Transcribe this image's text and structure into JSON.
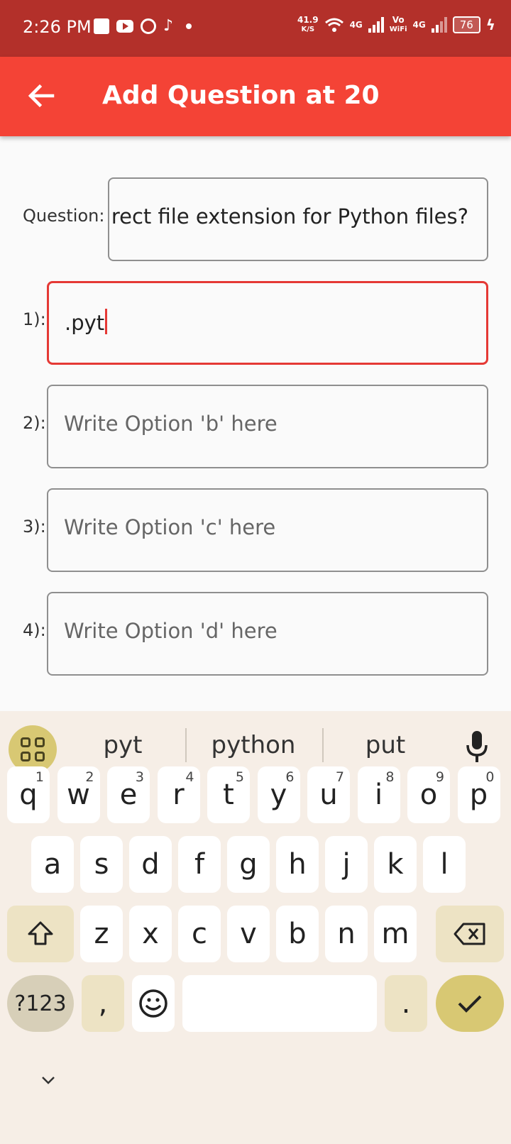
{
  "status_bar": {
    "time": "2:26 PM",
    "net_speed_value": "41.9",
    "net_speed_unit": "K/S",
    "network_1": "4G",
    "volte_top": "Vo",
    "volte_bottom": "WiFi",
    "network_2": "4G",
    "battery": "76",
    "icons": [
      "square-notification-icon",
      "youtube-icon",
      "whatsapp-icon",
      "tiktok-icon",
      "dot-icon",
      "wifi-icon",
      "signal-icon",
      "battery-icon",
      "charging-icon"
    ]
  },
  "app_bar": {
    "title": "Add Question at 20",
    "background": "#f44336",
    "status_background": "#b3302a"
  },
  "form": {
    "question_label": "Question:",
    "question_value": "rect file extension for Python files?",
    "options": [
      {
        "label": "1):",
        "value": ".pyt",
        "placeholder": ""
      },
      {
        "label": "2):",
        "value": "",
        "placeholder": "Write Option 'b' here"
      },
      {
        "label": "3):",
        "value": "",
        "placeholder": "Write Option 'c' here"
      },
      {
        "label": "4):",
        "value": "",
        "placeholder": "Write Option 'd' here"
      }
    ],
    "focus_color": "#e53935"
  },
  "keyboard": {
    "suggestions": [
      "pyt",
      "python",
      "put"
    ],
    "row1": [
      {
        "k": "q",
        "h": "1"
      },
      {
        "k": "w",
        "h": "2"
      },
      {
        "k": "e",
        "h": "3"
      },
      {
        "k": "r",
        "h": "4"
      },
      {
        "k": "t",
        "h": "5"
      },
      {
        "k": "y",
        "h": "6"
      },
      {
        "k": "u",
        "h": "7"
      },
      {
        "k": "i",
        "h": "8"
      },
      {
        "k": "o",
        "h": "9"
      },
      {
        "k": "p",
        "h": "0"
      }
    ],
    "row2": [
      "a",
      "s",
      "d",
      "f",
      "g",
      "h",
      "j",
      "k",
      "l"
    ],
    "row3": [
      "z",
      "x",
      "c",
      "v",
      "b",
      "n",
      "m"
    ],
    "symbols_label": "?123",
    "comma": ",",
    "period": ".",
    "accent": "#d8c873"
  }
}
